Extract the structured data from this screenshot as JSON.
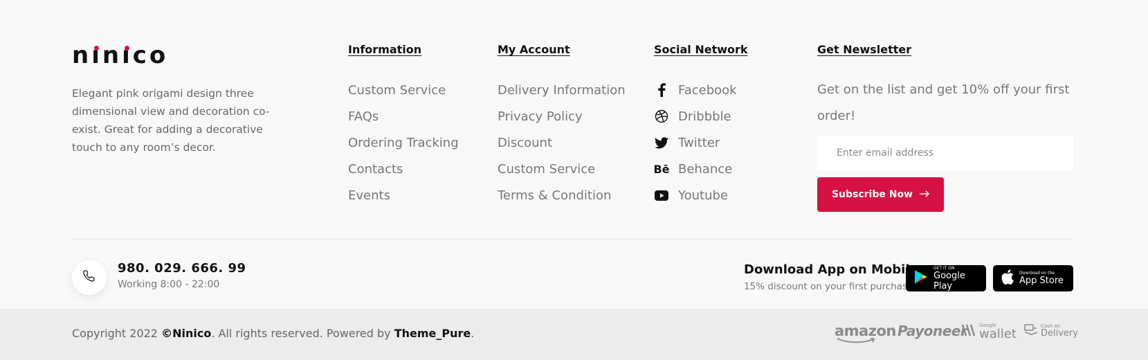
{
  "brand": {
    "logo": "ninico",
    "about": "Elegant pink origami design three dimensional view and decoration co-exist. Great for adding a decorative touch to any room’s decor."
  },
  "information": {
    "title": "Information",
    "items": [
      "Custom Service",
      "FAQs",
      "Ordering Tracking",
      "Contacts",
      "Events"
    ]
  },
  "account": {
    "title": "My Account",
    "items": [
      "Delivery Information",
      "Privacy Policy",
      "Discount",
      "Custom Service",
      "Terms & Condition"
    ]
  },
  "social": {
    "title": "Social Network",
    "items": [
      {
        "label": "Facebook",
        "icon": "facebook-icon"
      },
      {
        "label": "Dribbble",
        "icon": "dribbble-icon"
      },
      {
        "label": "Twitter",
        "icon": "twitter-icon"
      },
      {
        "label": "Behance",
        "icon": "behance-icon"
      },
      {
        "label": "Youtube",
        "icon": "youtube-icon"
      }
    ]
  },
  "newsletter": {
    "title": "Get Newsletter",
    "text": "Get on the list and get 10% off your first order!",
    "placeholder": "Enter email address",
    "button": "Subscribe Now"
  },
  "contact": {
    "phone": "980. 029. 666. 99",
    "hours": "Working 8:00 - 22:00"
  },
  "app": {
    "title": "Download App on Mobile",
    "subtitle": "15% discount on your first purchase",
    "google": {
      "small": "GET IT ON",
      "big": "Google Play"
    },
    "apple": {
      "small": "Download on the",
      "big": "App Store"
    }
  },
  "copyright": {
    "prefix": "Copyright 2022 ",
    "brand": "©Ninico",
    "middle": ". All rights reserved. Powered by ",
    "powered": "Theme_Pure",
    "suffix": "."
  },
  "payments": {
    "amazon": "amazon",
    "payoneer": "Payoneer",
    "wallet_small": "Google",
    "wallet_big": "wallet",
    "cod_small": "Cash on",
    "cod_big": "Delivery"
  },
  "colors": {
    "accent": "#d51243",
    "background": "#f8f8f8",
    "bottom_bar": "#ececec"
  }
}
